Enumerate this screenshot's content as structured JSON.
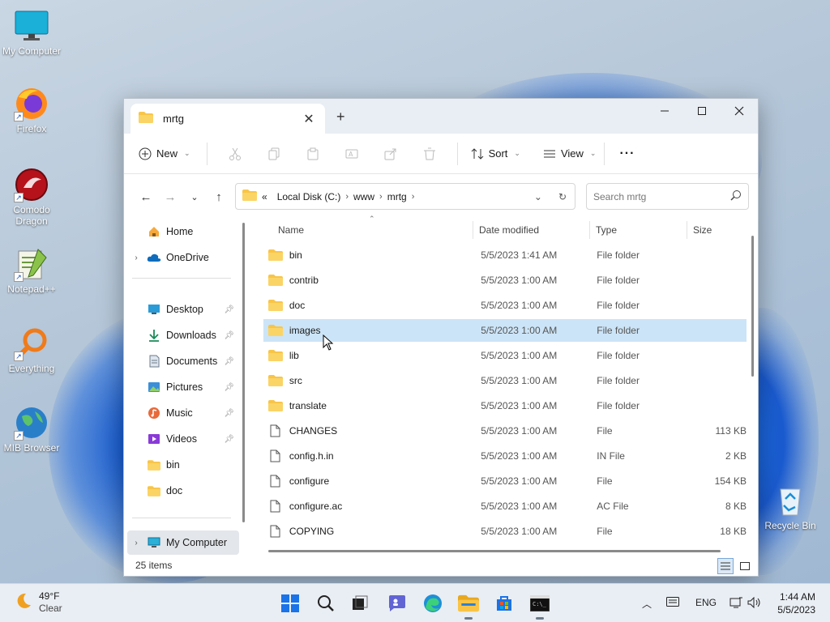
{
  "desktop": {
    "icons": [
      {
        "label": "My Computer"
      },
      {
        "label": "Firefox"
      },
      {
        "label": "Comodo Dragon"
      },
      {
        "label": "Notepad++"
      },
      {
        "label": "Everything"
      },
      {
        "label": "MIB Browser"
      },
      {
        "label": "Recycle Bin"
      }
    ]
  },
  "window": {
    "tab_title": "mrtg",
    "new_tab": "+",
    "toolbar": {
      "new_label": "New",
      "sort_label": "Sort",
      "view_label": "View",
      "more": "···"
    },
    "address": {
      "overflow": "«",
      "crumbs": [
        "Local Disk (C:)",
        "www",
        "mrtg"
      ]
    },
    "search": {
      "placeholder": "Search mrtg"
    },
    "sidebar": {
      "items": [
        {
          "label": "Home"
        },
        {
          "label": "OneDrive"
        },
        {
          "label": "Desktop"
        },
        {
          "label": "Downloads"
        },
        {
          "label": "Documents"
        },
        {
          "label": "Pictures"
        },
        {
          "label": "Music"
        },
        {
          "label": "Videos"
        },
        {
          "label": "bin"
        },
        {
          "label": "doc"
        },
        {
          "label": "My Computer"
        }
      ]
    },
    "columns": {
      "name": "Name",
      "date": "Date modified",
      "type": "Type",
      "size": "Size"
    },
    "files": [
      {
        "name": "bin",
        "date": "5/5/2023 1:41 AM",
        "type": "File folder",
        "size": "",
        "kind": "folder"
      },
      {
        "name": "contrib",
        "date": "5/5/2023 1:00 AM",
        "type": "File folder",
        "size": "",
        "kind": "folder"
      },
      {
        "name": "doc",
        "date": "5/5/2023 1:00 AM",
        "type": "File folder",
        "size": "",
        "kind": "folder"
      },
      {
        "name": "images",
        "date": "5/5/2023 1:00 AM",
        "type": "File folder",
        "size": "",
        "kind": "folder"
      },
      {
        "name": "lib",
        "date": "5/5/2023 1:00 AM",
        "type": "File folder",
        "size": "",
        "kind": "folder"
      },
      {
        "name": "src",
        "date": "5/5/2023 1:00 AM",
        "type": "File folder",
        "size": "",
        "kind": "folder"
      },
      {
        "name": "translate",
        "date": "5/5/2023 1:00 AM",
        "type": "File folder",
        "size": "",
        "kind": "folder"
      },
      {
        "name": "CHANGES",
        "date": "5/5/2023 1:00 AM",
        "type": "File",
        "size": "113 KB",
        "kind": "file"
      },
      {
        "name": "config.h.in",
        "date": "5/5/2023 1:00 AM",
        "type": "IN File",
        "size": "2 KB",
        "kind": "file"
      },
      {
        "name": "configure",
        "date": "5/5/2023 1:00 AM",
        "type": "File",
        "size": "154 KB",
        "kind": "file"
      },
      {
        "name": "configure.ac",
        "date": "5/5/2023 1:00 AM",
        "type": "AC File",
        "size": "8 KB",
        "kind": "file"
      },
      {
        "name": "COPYING",
        "date": "5/5/2023 1:00 AM",
        "type": "File",
        "size": "18 KB",
        "kind": "file"
      }
    ],
    "status": {
      "item_count": "25 items"
    }
  },
  "taskbar": {
    "weather": {
      "temp": "49°F",
      "condition": "Clear"
    },
    "lang": "ENG",
    "time": "1:44 AM",
    "date": "5/5/2023"
  },
  "colors": {
    "selection": "#cce4f7",
    "accent": "#0067c0",
    "folder": "#f8c548"
  }
}
